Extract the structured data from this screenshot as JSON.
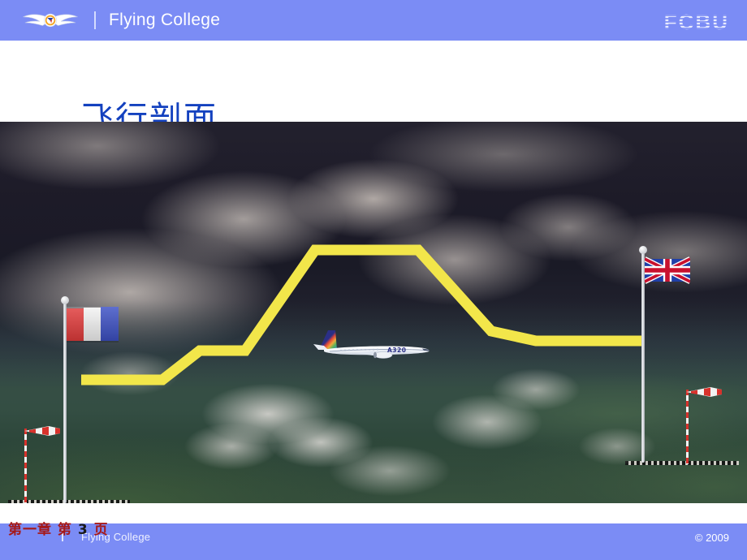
{
  "header": {
    "brand": "Flying College",
    "logo_icon": "winged-emblem-icon",
    "separator": "|",
    "watermark": "FCBU",
    "background_color": "#7b8cf5"
  },
  "title": {
    "text": "飞行剖面",
    "color": "#1341bf"
  },
  "picture": {
    "alt_name": "flight-profile-illustration",
    "aircraft": {
      "model_text": "A320",
      "livery": "airbus-house-livery"
    },
    "departure": {
      "flag": "france-flag",
      "windsock": "windsock-icon",
      "runway": "runway-strip"
    },
    "arrival": {
      "flag": "united-kingdom-flag",
      "windsock": "windsock-icon",
      "runway": "runway-strip"
    },
    "path_color": "#f2e64a"
  },
  "chart_data": {
    "type": "line",
    "title": "飞行剖面",
    "xlabel": "",
    "ylabel": "",
    "series": [
      {
        "name": "flight-profile",
        "points": [
          {
            "x": 100,
            "y": 468,
            "phase": "takeoff-roll-start"
          },
          {
            "x": 200,
            "y": 468,
            "phase": "rotation"
          },
          {
            "x": 246,
            "y": 432,
            "phase": "initial-climb-level-off"
          },
          {
            "x": 302,
            "y": 432,
            "phase": "acceleration-segment"
          },
          {
            "x": 388,
            "y": 308,
            "phase": "climb-to-cruise"
          },
          {
            "x": 515,
            "y": 308,
            "phase": "cruise-end"
          },
          {
            "x": 605,
            "y": 408,
            "phase": "descent-level-off"
          },
          {
            "x": 660,
            "y": 420,
            "phase": "approach"
          },
          {
            "x": 790,
            "y": 420,
            "phase": "touchdown"
          }
        ]
      }
    ],
    "annotations": [
      {
        "label": "A320",
        "at_x": 460,
        "at_y": 278
      },
      {
        "label": "departure airport",
        "at_x": 85,
        "at_y": 420
      },
      {
        "label": "destination airport",
        "at_x": 800,
        "at_y": 340
      }
    ],
    "grid": false,
    "legend": "none"
  },
  "footer": {
    "chapter_prefix": "第一章  第",
    "chapter_number": "3",
    "chapter_suffix": "页",
    "separator": "|",
    "brand": "Flying College",
    "copyright": "© 2009",
    "background_color": "#7b8cf5"
  }
}
